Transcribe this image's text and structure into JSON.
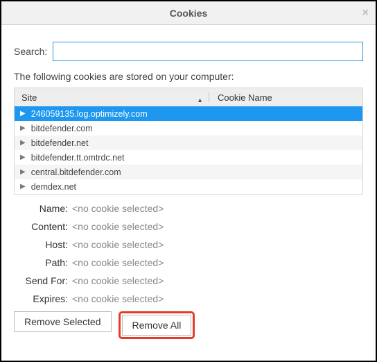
{
  "dialog": {
    "title": "Cookies",
    "close_glyph": "×"
  },
  "search": {
    "label": "Search:",
    "value": ""
  },
  "intro": "The following cookies are stored on your computer:",
  "columns": {
    "site": "Site",
    "cookie_name": "Cookie Name"
  },
  "rows": [
    {
      "site": "246059135.log.optimizely.com",
      "selected": true
    },
    {
      "site": "bitdefender.com",
      "selected": false
    },
    {
      "site": "bitdefender.net",
      "selected": false
    },
    {
      "site": "bitdefender.tt.omtrdc.net",
      "selected": false
    },
    {
      "site": "central.bitdefender.com",
      "selected": false
    },
    {
      "site": "demdex.net",
      "selected": false
    }
  ],
  "details": {
    "name_label": "Name:",
    "content_label": "Content:",
    "host_label": "Host:",
    "path_label": "Path:",
    "sendfor_label": "Send For:",
    "expires_label": "Expires:",
    "placeholder": "<no cookie selected>"
  },
  "buttons": {
    "remove_selected": "Remove Selected",
    "remove_all": "Remove All"
  }
}
